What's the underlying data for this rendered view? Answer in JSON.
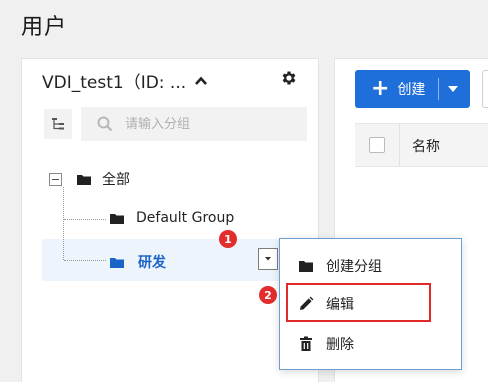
{
  "page": {
    "title": "用户"
  },
  "left_panel": {
    "project_name": "VDI_test1（ID: ...",
    "search_placeholder": "请输入分组",
    "tree": [
      {
        "label": "全部"
      },
      {
        "label": "Default Group"
      },
      {
        "label": "研发",
        "selected": true
      }
    ]
  },
  "context_menu": {
    "items": [
      {
        "label": "创建分组",
        "icon": "folder-icon"
      },
      {
        "label": "编辑",
        "icon": "pencil-icon"
      },
      {
        "label": "删除",
        "icon": "trash-icon"
      }
    ]
  },
  "annotations": {
    "step1": "1",
    "step2": "2"
  },
  "right_panel": {
    "create_label": "创建",
    "columns": [
      "名称"
    ]
  },
  "colors": {
    "primary": "#1e6fd9",
    "selected_text": "#1a64c8",
    "badge": "#e32c2c",
    "highlight_border": "#e02a2a"
  }
}
